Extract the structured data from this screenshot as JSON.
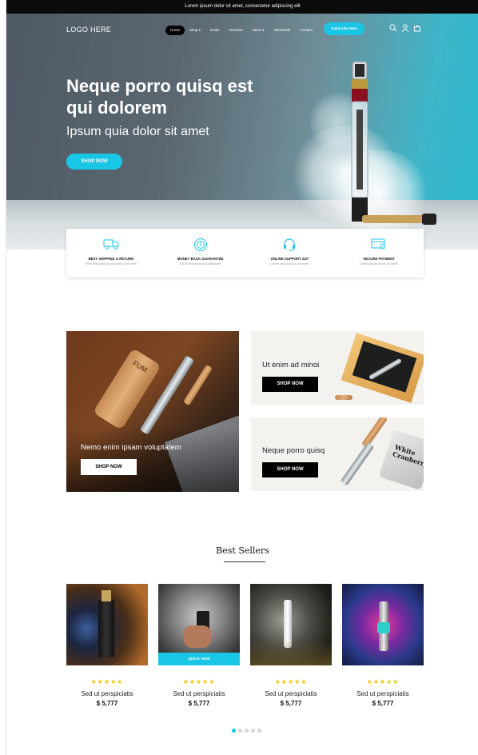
{
  "announcement": "Lorem ipsum dolor sit amet, consectetur adipiscing elit",
  "nav": {
    "logo": "LOGO HERE",
    "items": [
      "Home",
      "Shop ▾",
      "Deals",
      "Reviews",
      "News ▾",
      "Wholesale",
      "Contact"
    ],
    "active_index": 0,
    "subscribe_label": "Subscribe Now",
    "icons": [
      "search-icon",
      "user-icon",
      "cart-icon"
    ]
  },
  "hero": {
    "title": "Neque porro quisq est qui dolorem",
    "subtitle": "Ipsum quia dolor sit amet",
    "button_label": "SHOP NOW"
  },
  "features": [
    {
      "icon": "truck-icon",
      "title": "BEST SHIPPING & RETURN",
      "desc": "Free shipping on all orders over $99"
    },
    {
      "icon": "money-back-icon",
      "title": "MONEY BACK GUARANTEE",
      "desc": "100% money back guarantee"
    },
    {
      "icon": "headset-icon",
      "title": "ONLINE SUPPORT 24/7",
      "desc": "Lorem ipsum dolor sit amet."
    },
    {
      "icon": "secure-payment-icon",
      "title": "SECURE PAYMENT",
      "desc": "Lorem ipsum dolor sit amet."
    }
  ],
  "promos": {
    "big": {
      "text": "Nemo enim ipsam voluptatem",
      "button_label": "SHOP NOW",
      "product_text": "FUM"
    },
    "small_one": {
      "text": "Ut enim ad minoi",
      "button_label": "SHOP NOW"
    },
    "small_two": {
      "text": "Neque porro quisq",
      "button_label": "SHOP NOW",
      "pack_text": "White Cranberry"
    }
  },
  "best_sellers": {
    "title": "Best Sellers",
    "quick_view_label": "QUICK VIEW",
    "products": [
      {
        "stars": "★★★★★",
        "name": "Sed ut perspiciatis",
        "price": "$ 5,777"
      },
      {
        "stars": "★★★★★",
        "name": "Sed ut perspiciatis",
        "price": "$ 5,777"
      },
      {
        "stars": "★★★★★",
        "name": "Sed ut perspiciatis",
        "price": "$ 5,777"
      },
      {
        "stars": "★★★★★",
        "name": "Sed ut perspiciatis",
        "price": "$ 5,777"
      }
    ],
    "pagination": {
      "total": 5,
      "active": 0
    }
  },
  "colors": {
    "accent": "#19c6e6",
    "star": "#f5c400",
    "dark": "#0b0b0b"
  }
}
